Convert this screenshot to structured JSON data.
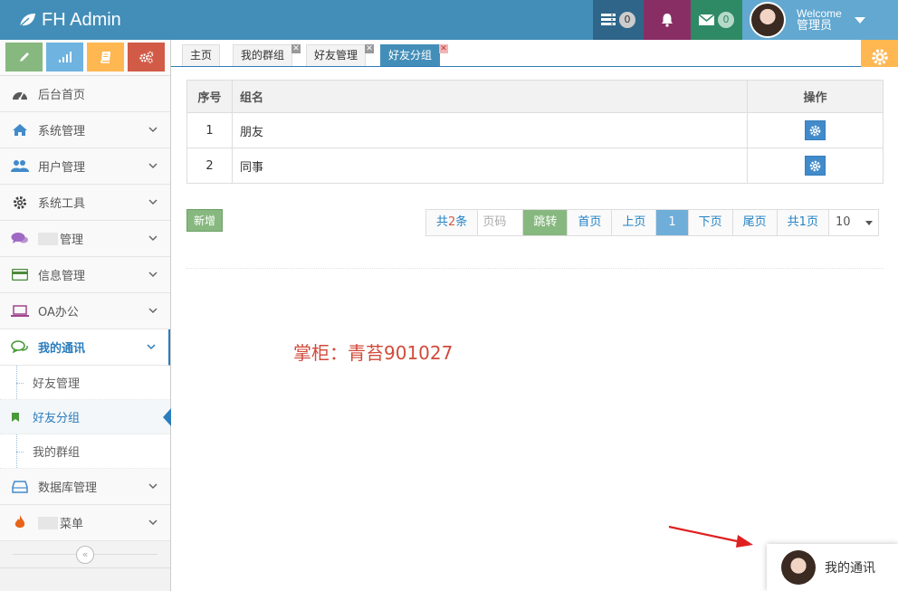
{
  "app": {
    "brand": "FH Admin"
  },
  "header": {
    "tasks_count": "0",
    "messages_count": "0",
    "welcome": "Welcome",
    "user_name": "管理员"
  },
  "sidebar": {
    "menu": [
      {
        "label": "后台首页",
        "icon": "dashboard-icon"
      },
      {
        "label": "系统管理",
        "icon": "home-icon"
      },
      {
        "label": "用户管理",
        "icon": "users-icon"
      },
      {
        "label": "系统工具",
        "icon": "cog-icon"
      },
      {
        "label": "管理",
        "icon": "comments-icon"
      },
      {
        "label": "信息管理",
        "icon": "credit-card-icon"
      },
      {
        "label": "OA办公",
        "icon": "laptop-icon"
      },
      {
        "label": "我的通讯",
        "icon": "chat-icon"
      },
      {
        "label": "数据库管理",
        "icon": "hdd-icon"
      },
      {
        "label": "菜单",
        "icon": "fire-icon"
      }
    ],
    "submenu": [
      {
        "label": "好友管理"
      },
      {
        "label": "好友分组"
      },
      {
        "label": "我的群组"
      }
    ]
  },
  "tabs": [
    {
      "label": "主页"
    },
    {
      "label": "我的群组"
    },
    {
      "label": "好友管理"
    },
    {
      "label": "好友分组"
    }
  ],
  "table": {
    "headers": [
      "序号",
      "组名",
      "操作"
    ],
    "rows": [
      {
        "index": "1",
        "name": "朋友"
      },
      {
        "index": "2",
        "name": "同事"
      }
    ]
  },
  "buttons": {
    "add": "新增"
  },
  "pager": {
    "total_prefix": "共",
    "total_count": "2",
    "total_suffix": "条",
    "page_input_placeholder": "页码",
    "jump": "跳转",
    "first": "首页",
    "prev": "上页",
    "current": "1",
    "next": "下页",
    "last": "尾页",
    "pages": "共1页",
    "page_size": "10"
  },
  "note": "掌柜：青苔901027",
  "chat": {
    "label": "我的通讯"
  },
  "colors": {
    "navbar": "#438eb9",
    "accent": "#2b7dbc",
    "note": "#d14a3a"
  }
}
